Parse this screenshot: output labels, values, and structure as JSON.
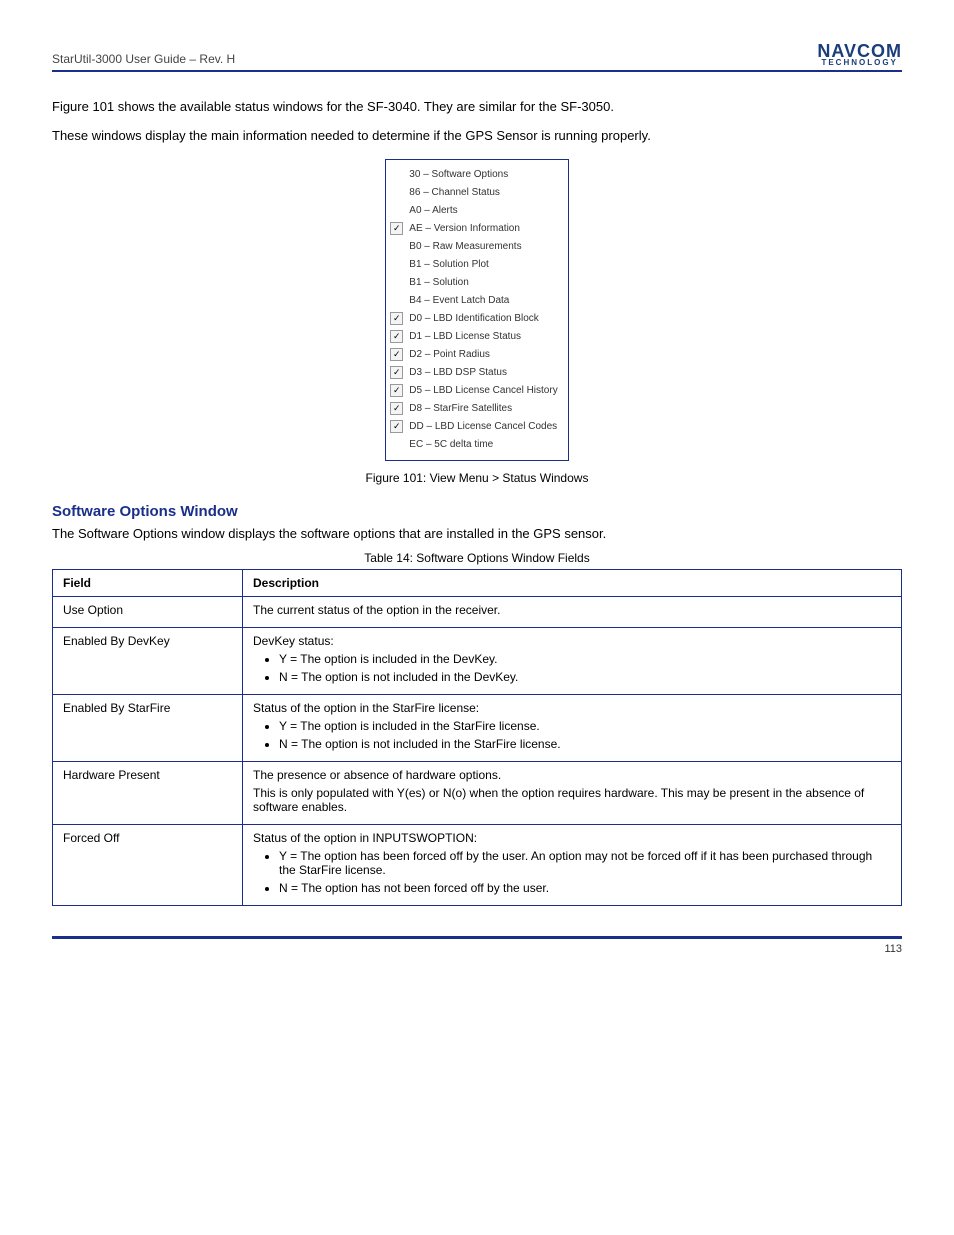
{
  "header": {
    "title": "StarUtil-3000 User Guide – Rev. H",
    "logo_main": "NAVCOM",
    "logo_sub": "TECHNOLOGY"
  },
  "intro": {
    "p1": "Figure 101 shows the available status windows for the SF-3040. They are similar for the SF-3050.",
    "p2": "These windows display the main information needed to determine if the GPS Sensor is running properly."
  },
  "menu": [
    {
      "checked": false,
      "label": "30 – Software Options"
    },
    {
      "checked": false,
      "label": "86 – Channel Status"
    },
    {
      "checked": false,
      "label": "A0 – Alerts"
    },
    {
      "checked": true,
      "label": "AE – Version Information"
    },
    {
      "checked": false,
      "label": "B0 – Raw Measurements"
    },
    {
      "checked": false,
      "label": "B1 – Solution Plot"
    },
    {
      "checked": false,
      "label": "B1 – Solution"
    },
    {
      "checked": false,
      "label": "B4 – Event Latch Data"
    },
    {
      "checked": true,
      "label": "D0 – LBD Identification Block"
    },
    {
      "checked": true,
      "label": "D1 – LBD License Status"
    },
    {
      "checked": true,
      "label": "D2 – Point Radius"
    },
    {
      "checked": true,
      "label": "D3 – LBD DSP Status"
    },
    {
      "checked": true,
      "label": "D5 – LBD License Cancel History"
    },
    {
      "checked": true,
      "label": "D8 – StarFire Satellites"
    },
    {
      "checked": true,
      "label": "DD – LBD License Cancel Codes"
    },
    {
      "checked": false,
      "label": "EC – 5C delta time"
    }
  ],
  "figure_caption": "Figure 101: View Menu > Status Windows",
  "section_title": "Software Options Window",
  "section_para": "The Software Options window displays the software options that are installed in the GPS sensor.",
  "table_caption": "Table 14: Software Options Window Fields",
  "table": {
    "headers": [
      "Field",
      "Description"
    ],
    "rows": [
      {
        "field": "Use Option",
        "desc_lines": [
          "The current status of the option in the receiver."
        ]
      },
      {
        "field": "Enabled By DevKey",
        "desc_lines": [
          "DevKey status:"
        ],
        "bullets": [
          "Y = The option is included in the DevKey.",
          "N = The option is not included in the DevKey."
        ]
      },
      {
        "field": "Enabled By StarFire",
        "desc_lines": [
          "Status of the option in the StarFire license:"
        ],
        "bullets": [
          "Y = The option is included in the StarFire license.",
          "N = The option is not included in the StarFire license."
        ]
      },
      {
        "field": "Hardware Present",
        "desc_lines": [
          "The presence or absence of hardware options.",
          "This is only populated with Y(es) or N(o) when the option requires hardware. This may be present in the absence of software enables."
        ]
      },
      {
        "field": "Forced Off",
        "desc_lines": [
          "Status of the option in INPUTSWOPTION:"
        ],
        "bullets": [
          "Y = The option has been forced off by the user. An option may not be forced off if it has been purchased through the StarFire license.",
          "N = The option has not been forced off by the user."
        ]
      }
    ]
  },
  "footer": {
    "left": "",
    "right": "113"
  }
}
